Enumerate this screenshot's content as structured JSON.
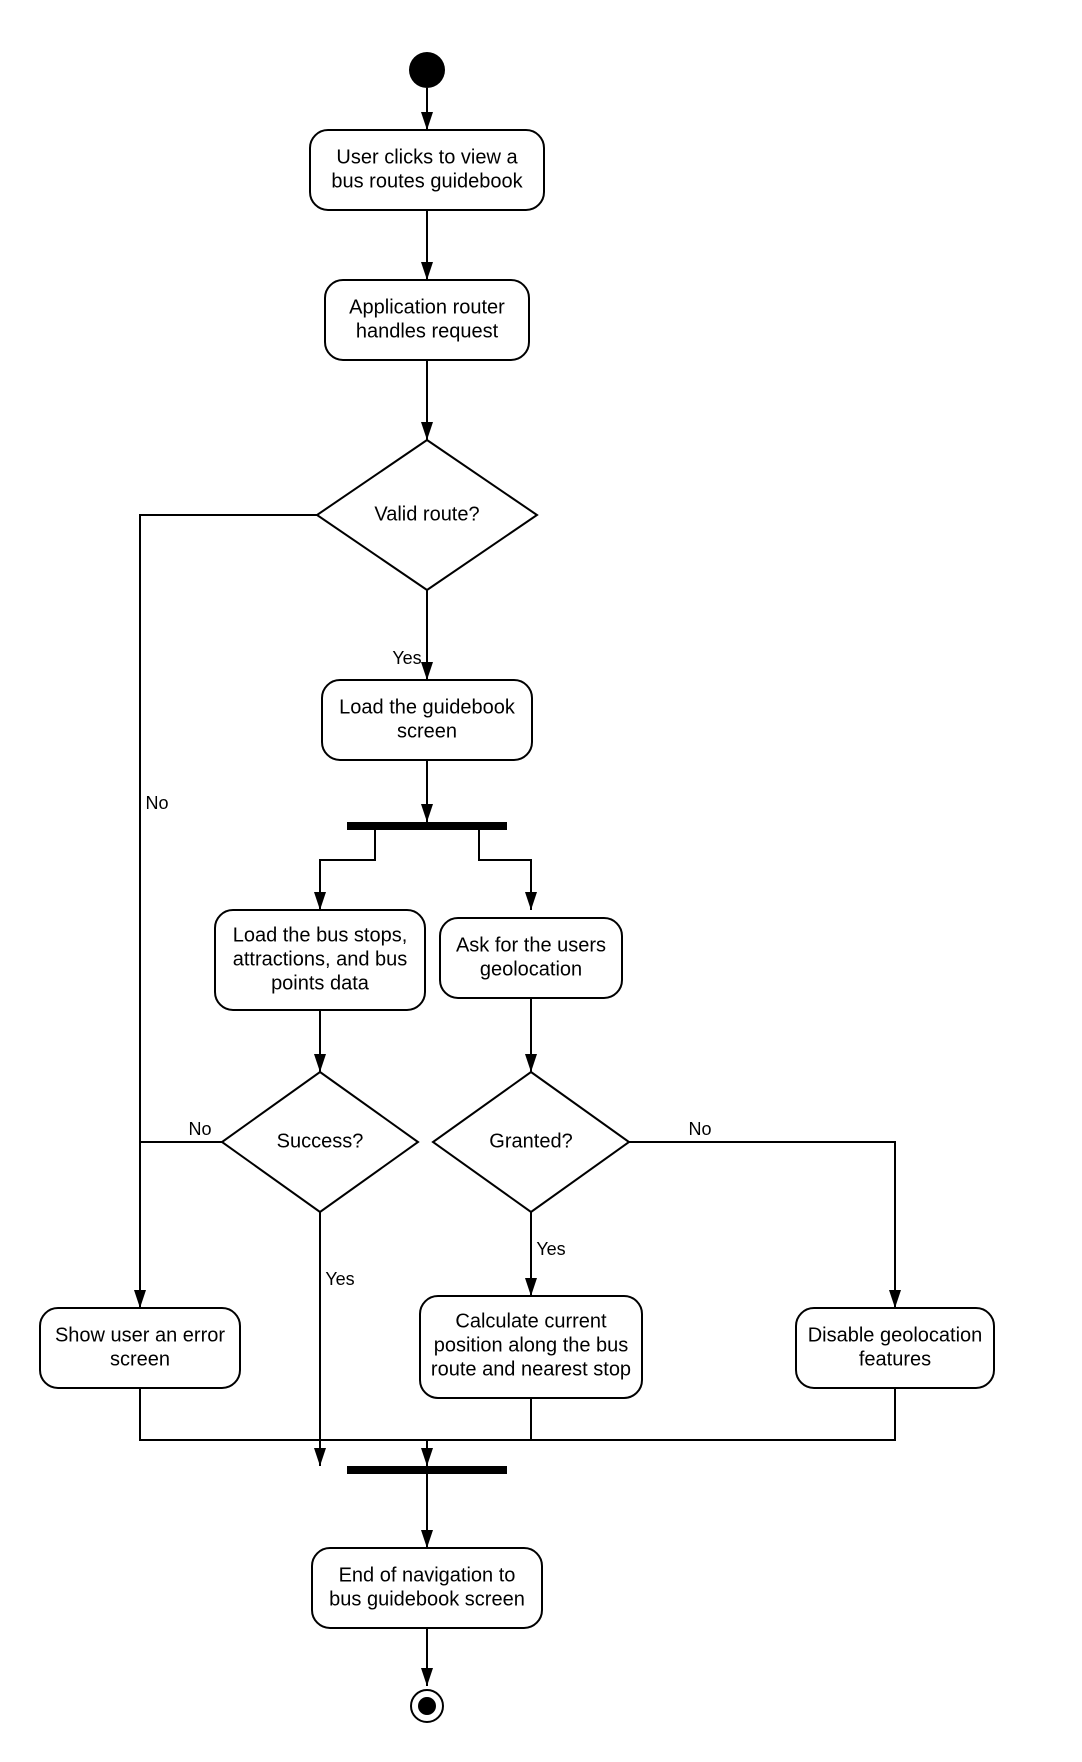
{
  "diagram": {
    "type": "activity-diagram",
    "nodes": {
      "start": {
        "type": "initial"
      },
      "n1": {
        "type": "activity",
        "text_lines": [
          "User clicks to view a",
          "bus routes guidebook"
        ]
      },
      "n2": {
        "type": "activity",
        "text_lines": [
          "Application router",
          "handles request"
        ]
      },
      "d1": {
        "type": "decision",
        "text": "Valid route?"
      },
      "n3": {
        "type": "activity",
        "text_lines": [
          "Load the guidebook",
          "screen"
        ]
      },
      "fork": {
        "type": "fork"
      },
      "n4": {
        "type": "activity",
        "text_lines": [
          "Load the bus stops,",
          "attractions, and bus",
          "points data"
        ]
      },
      "n5": {
        "type": "activity",
        "text_lines": [
          "Ask for the users",
          "geolocation"
        ]
      },
      "d2": {
        "type": "decision",
        "text": "Success?"
      },
      "d3": {
        "type": "decision",
        "text": "Granted?"
      },
      "n6": {
        "type": "activity",
        "text_lines": [
          "Show user an error",
          "screen"
        ]
      },
      "n7": {
        "type": "activity",
        "text_lines": [
          "Calculate current",
          "position along the bus",
          "route and nearest stop"
        ]
      },
      "n8": {
        "type": "activity",
        "text_lines": [
          "Disable geolocation",
          "features"
        ]
      },
      "join": {
        "type": "join"
      },
      "n9": {
        "type": "activity",
        "text_lines": [
          "End of navigation to",
          "bus guidebook screen"
        ]
      },
      "end": {
        "type": "final"
      }
    },
    "edges": {
      "e_start_n1": {
        "from": "start",
        "to": "n1"
      },
      "e_n1_n2": {
        "from": "n1",
        "to": "n2"
      },
      "e_n2_d1": {
        "from": "n2",
        "to": "d1"
      },
      "e_d1_yes": {
        "from": "d1",
        "to": "n3",
        "label": "Yes"
      },
      "e_d1_no": {
        "from": "d1",
        "to": "n6",
        "label": "No"
      },
      "e_n3_fork": {
        "from": "n3",
        "to": "fork"
      },
      "e_fork_n4": {
        "from": "fork",
        "to": "n4"
      },
      "e_fork_n5": {
        "from": "fork",
        "to": "n5"
      },
      "e_n4_d2": {
        "from": "n4",
        "to": "d2"
      },
      "e_n5_d3": {
        "from": "n5",
        "to": "d3"
      },
      "e_d2_no": {
        "from": "d2",
        "to": "n6",
        "label": "No"
      },
      "e_d2_yes": {
        "from": "d2",
        "to": "join",
        "label": "Yes"
      },
      "e_d3_yes": {
        "from": "d3",
        "to": "n7",
        "label": "Yes"
      },
      "e_d3_no": {
        "from": "d3",
        "to": "n8",
        "label": "No"
      },
      "e_n6_join": {
        "from": "n6",
        "to": "join"
      },
      "e_n7_join": {
        "from": "n7",
        "to": "join"
      },
      "e_n8_join": {
        "from": "n8",
        "to": "join"
      },
      "e_join_n9": {
        "from": "join",
        "to": "n9"
      },
      "e_n9_end": {
        "from": "n9",
        "to": "end"
      }
    }
  }
}
